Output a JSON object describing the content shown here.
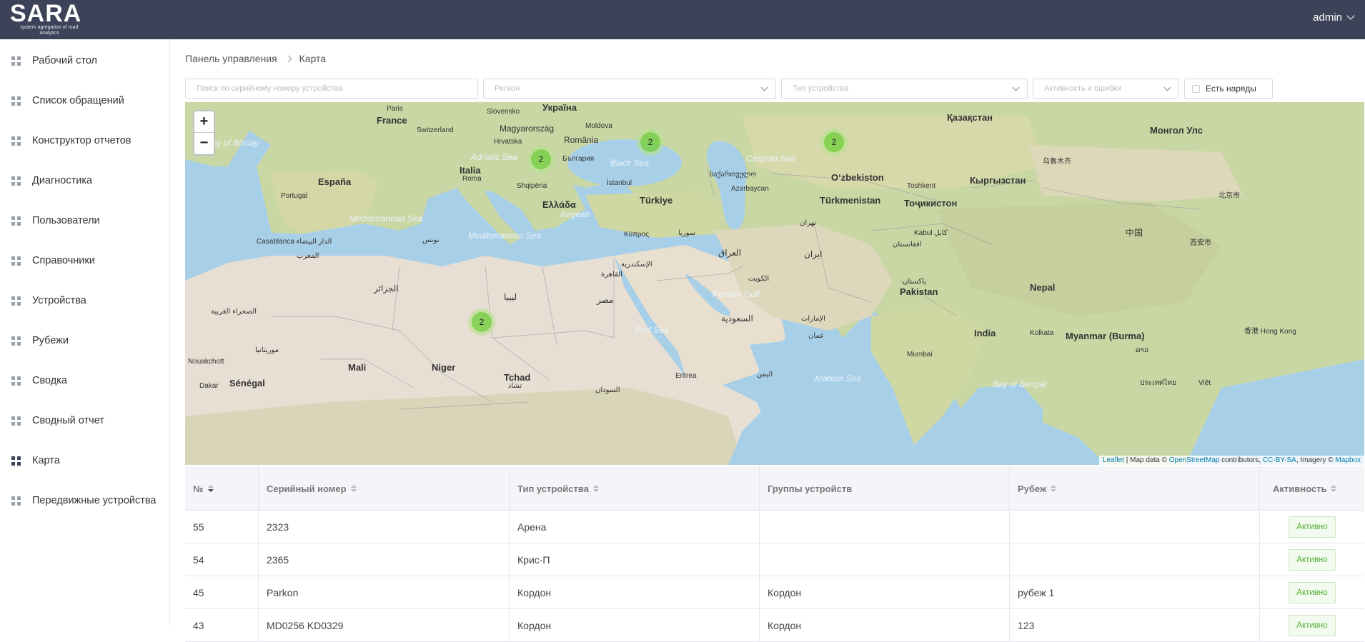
{
  "header": {
    "logo_title": "SARA",
    "logo_subtitle": "system agregation of road analytics",
    "user_name": "admin"
  },
  "sidebar": {
    "items": [
      {
        "label": "Рабочий стол",
        "active": false
      },
      {
        "label": "Список обращений",
        "active": false
      },
      {
        "label": "Конструктор отчетов",
        "active": false
      },
      {
        "label": "Диагностика",
        "active": false
      },
      {
        "label": "Пользователи",
        "active": false
      },
      {
        "label": "Справочники",
        "active": false
      },
      {
        "label": "Устройства",
        "active": false
      },
      {
        "label": "Рубежи",
        "active": false
      },
      {
        "label": "Сводка",
        "active": false
      },
      {
        "label": "Сводный отчет",
        "active": false
      },
      {
        "label": "Карта",
        "active": true
      },
      {
        "label": "Передвижные устройства",
        "active": false
      }
    ]
  },
  "breadcrumb": {
    "root": "Панель управления",
    "current": "Карта"
  },
  "filters": {
    "search_placeholder": "Поиск по серийному номеру устройства",
    "region_placeholder": "Регион",
    "device_type_placeholder": "Тип устройства",
    "activity_placeholder": "Активность и ошибки",
    "has_orders_label": "Есть наряды"
  },
  "map": {
    "zoom_in": "+",
    "zoom_out": "−",
    "clusters": [
      {
        "count": "2",
        "region": "Balkans"
      },
      {
        "count": "2",
        "region": "Black Sea"
      },
      {
        "count": "2",
        "region": "Kazakhstan"
      },
      {
        "count": "2",
        "region": "Algeria"
      }
    ],
    "attribution": {
      "leaflet": "Leaflet",
      "sep1": " | Map data © ",
      "osm": "OpenStreetMap",
      "sep2": " contributors, ",
      "license": "CC-BY-SA",
      "sep3": ", Imagery © ",
      "mapbox": "Mapbox"
    },
    "labels": {
      "ukraina": "Україна",
      "qazaqstan": "Қазақстан",
      "mongol": "Монгол Улс",
      "paris": "Paris",
      "slovensko": "Slovensko",
      "moldova": "Moldova",
      "france": "France",
      "switzerland": "Switzerland",
      "magyarorszag": "Magyarország",
      "romania": "România",
      "hrvatska": "Hrvatska",
      "italia": "Italia",
      "bulgaria": "България",
      "espana": "España",
      "portugal": "Portugal",
      "roma": "Roma",
      "shqiperia": "Shqipëria",
      "istanbul": "İstanbul",
      "ellada": "Ελλάδα",
      "turkiye": "Türkiye",
      "azerbaycan": "Azərbaycan",
      "sakartvelo": "საქართველო",
      "ozbekiston": "O‘zbekiston",
      "kyrgyzstan": "Кыргызстан",
      "toshkent": "Toshkent",
      "turkmenistan": "Türkmenistan",
      "tochikiston": "Тоҷикистон",
      "urumqi": "乌鲁木齐",
      "beijing": "北京市",
      "zhongguo": "中国",
      "xian": "西安市",
      "tehran": "تهران",
      "kabul": "Kabul کابل",
      "afghanistan": "افغانستان",
      "kypros": "Κύπρος",
      "suriya": "سوريا",
      "iraq": "العراق",
      "iran": "ایران",
      "kuwait": "الكويت",
      "pakistan": "Pakistan",
      "pakistan_ur": "پاکستان",
      "casablanca": "Casablanca الدار البيضاء",
      "maghrib": "المغرب",
      "tunis": "تونس",
      "jazair": "الجزائر",
      "libya": "ليبيا",
      "iskandariya": "الإسكندرية",
      "qahira": "القاهرة",
      "misr": "مصر",
      "saudi": "السعودية",
      "oman": "عمان",
      "emirates": "الإمارات",
      "sahara": "الصحراء الغربية",
      "mauritania": "موريتانيا",
      "nouakchott": "Nouakchott",
      "mali": "Mali",
      "niger": "Niger",
      "tchad": "Tchad",
      "tchad_ar": "تشاد",
      "dakar": "Dakar",
      "senegal": "Sénégal",
      "eritrea": "Eritrea",
      "yemen": "اليمن",
      "sudan": "السودان",
      "nepal": "Nepal",
      "india": "India",
      "kolkata": "Kolkata",
      "mumbai": "Mumbai",
      "myanmar": "Myanmar (Burma)",
      "lao": "ລາວ",
      "hongkong": "香港 Hong Kong",
      "thai": "ประเทศไทย",
      "viet": "Việt",
      "sea_biscay": "Bay of Biscay",
      "sea_med": "Mediterranean Sea",
      "sea_black": "Black Sea",
      "sea_caspian": "Caspian Sea",
      "sea_red": "Red Sea",
      "sea_persian": "Persian Gulf",
      "sea_arabian": "Arabian Sea",
      "sea_bengal": "Bay of Bengal",
      "sea_adriatic": "Adriatic Sea",
      "sea_aegean": "Aegean"
    }
  },
  "table": {
    "headers": [
      {
        "label": "№",
        "sortable": true,
        "sort": "desc"
      },
      {
        "label": "Серийный номер",
        "sortable": true,
        "sort": "none"
      },
      {
        "label": "Тип устройства",
        "sortable": true,
        "sort": "none"
      },
      {
        "label": "Группы устройств",
        "sortable": false,
        "sort": "none"
      },
      {
        "label": "Рубеж",
        "sortable": true,
        "sort": "none"
      },
      {
        "label": "Активность",
        "sortable": true,
        "sort": "none"
      }
    ],
    "rows": [
      {
        "id": "55",
        "serial": "2323",
        "type": "Арена",
        "group": "",
        "line": "",
        "activity": "Активно"
      },
      {
        "id": "54",
        "serial": "2365",
        "type": "Крис-П",
        "group": "",
        "line": "",
        "activity": "Активно"
      },
      {
        "id": "45",
        "serial": "Parkon",
        "type": "Кордон",
        "group": "Кордон",
        "line": "рубеж 1",
        "activity": "Активно"
      },
      {
        "id": "43",
        "serial": "MD0256 KD0329",
        "type": "Кордон",
        "group": "Кордон",
        "line": "123",
        "activity": "Активно"
      }
    ]
  },
  "colors": {
    "topbar": "#3c4258",
    "water": "#a8cfe8",
    "land_green": "#c9d7a5",
    "land_desert": "#e7dfd3",
    "cluster": "#6ecc39",
    "active_badge": "#52b030"
  }
}
